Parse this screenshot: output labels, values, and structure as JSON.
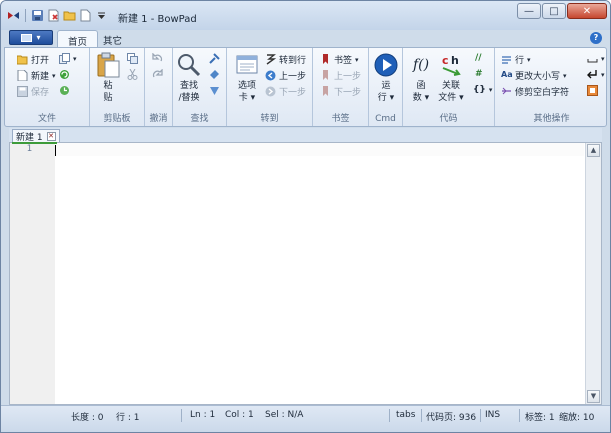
{
  "window": {
    "title": "新建 1 - BowPad",
    "buttons": {
      "minimize": "—",
      "maximize": "□",
      "close": "✕"
    }
  },
  "ribbon_tabs": [
    {
      "label": "首页",
      "active": true
    },
    {
      "label": "其它",
      "active": false
    }
  ],
  "app_menu": {
    "arrow": "▾"
  },
  "help": "?",
  "groups": {
    "file": {
      "label": "文件",
      "open": "打开",
      "new": "新建",
      "save": "保存"
    },
    "clipboard": {
      "label": "剪贴板",
      "paste_line1": "粘",
      "paste_line2": "贴"
    },
    "undo": {
      "label": "撤消"
    },
    "find": {
      "label": "查找",
      "big_line1": "查找",
      "big_line2": "/替换"
    },
    "goto": {
      "label": "转到",
      "tabs_line1": "选项",
      "tabs_line2": "卡",
      "goto_line": "转到行",
      "prev": "上一步",
      "next": "下一步"
    },
    "bookmarks": {
      "label": "书签",
      "bookmark": "书签",
      "prev": "上一步",
      "next": "下一步"
    },
    "cmd": {
      "label": "Cmd",
      "run": "运",
      "run2": "行"
    },
    "code": {
      "label": "代码",
      "func": "函",
      "func2": "数",
      "func_icon": "f()",
      "related": "关联",
      "related2": "文件",
      "hash1": "//",
      "hash2": "#",
      "braces": "{}"
    },
    "other": {
      "label": "其他操作",
      "lines": "行",
      "case": "更改大小写",
      "trim": "修剪空白字符"
    }
  },
  "document": {
    "tab_label": "新建 1",
    "tab_close": "✕",
    "line_numbers": [
      "1"
    ]
  },
  "scrollbar": {
    "up": "▲",
    "down": "▼"
  },
  "statusbar": {
    "length": "长度 : 0",
    "lines": "行 : 1",
    "ln": "Ln : 1",
    "col": "Col : 1",
    "sel": "Sel : N/A",
    "tabs": "tabs",
    "codepage": "代码页: 936",
    "ins": "INS",
    "tags": "标签: 1",
    "zoom": "缩放: 10"
  },
  "colors": {
    "accent": "#1f4d9b",
    "ribbon_bg": "#dfe8f4",
    "active_tab_line": "#3d9b3a"
  }
}
